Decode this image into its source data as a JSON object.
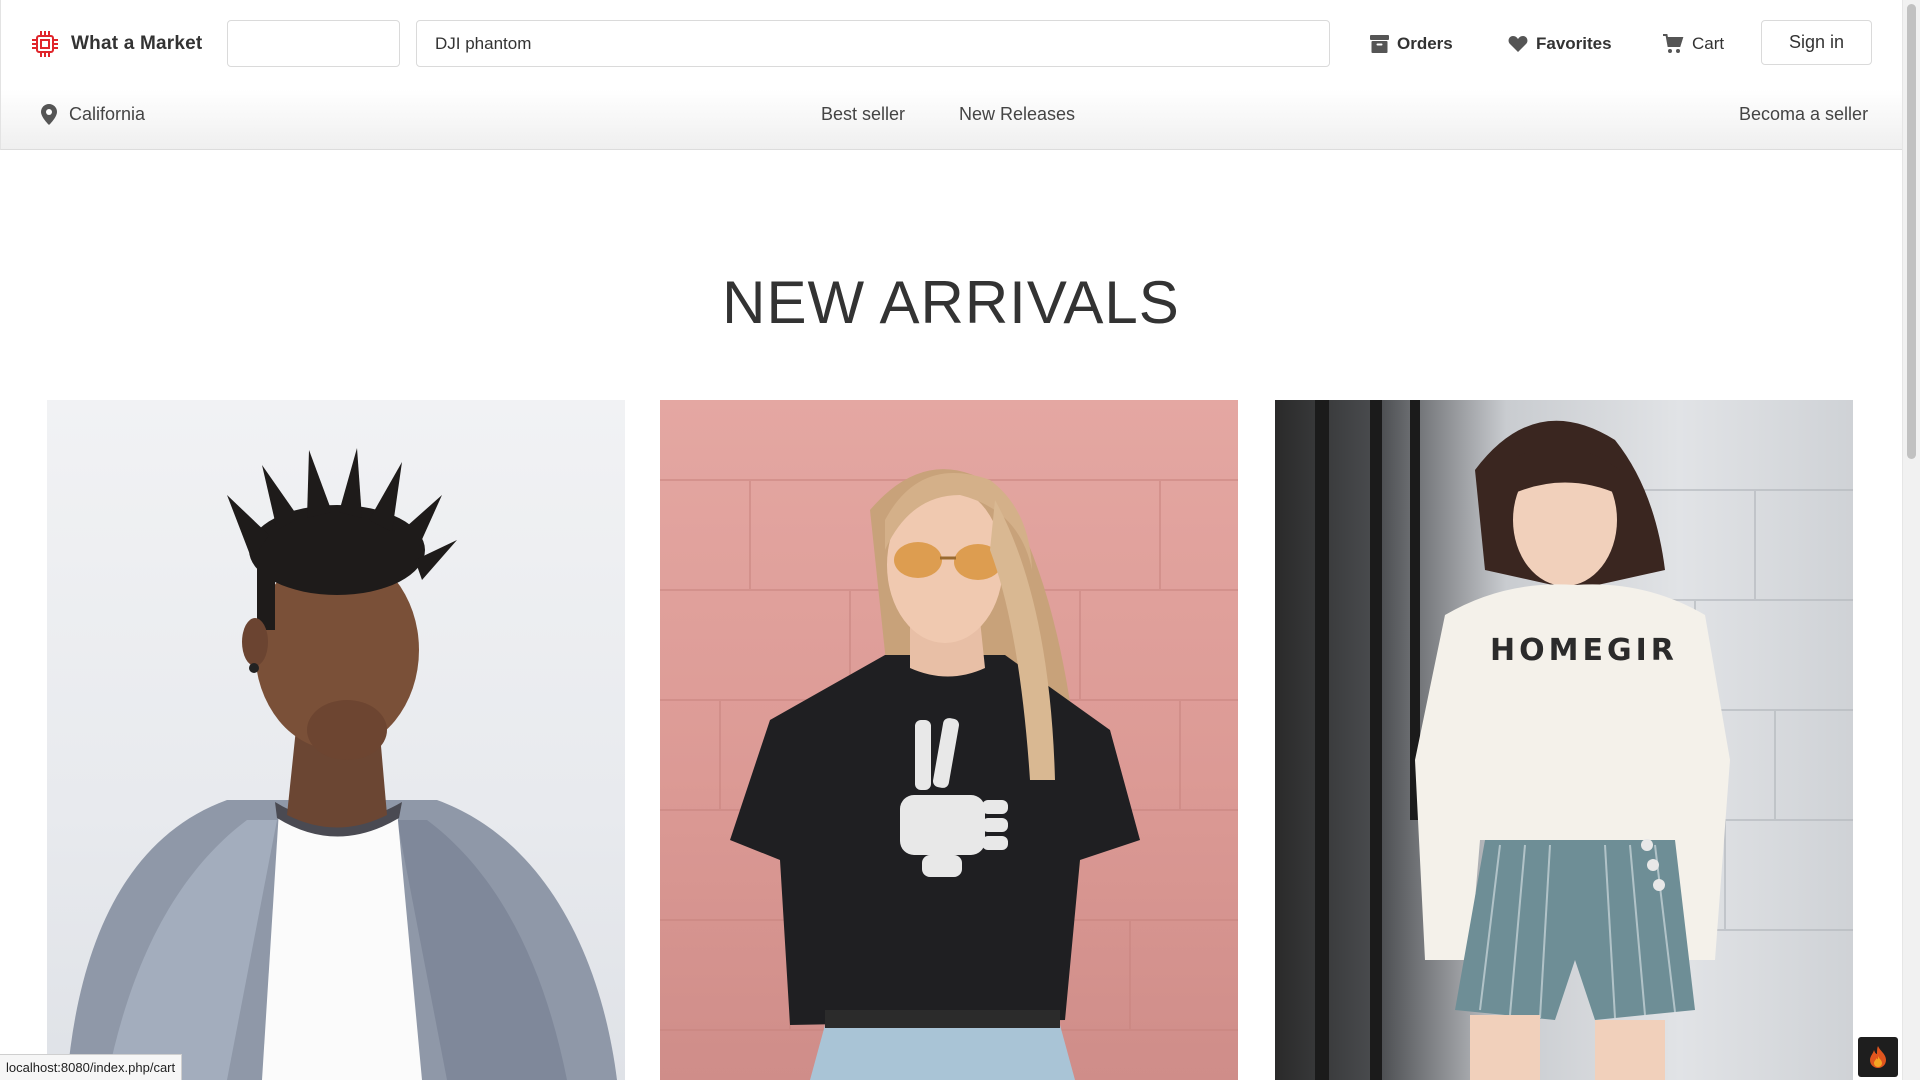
{
  "header": {
    "brand_name": "What a Market",
    "brand_color": "#e0252b",
    "category_value": "",
    "search_value": "DJI phantom",
    "orders_label": "Orders",
    "favorites_label": "Favorites",
    "cart_label": "Cart",
    "signin_label": "Sign in"
  },
  "subnav": {
    "location_label": "California",
    "links": [
      "Best seller",
      "New Releases"
    ],
    "seller_label": "Becoma a seller"
  },
  "main": {
    "section_title": "NEW ARRIVALS",
    "products": [
      {
        "image": "man-in-grey-blazer"
      },
      {
        "image": "woman-black-tee-pink-wall"
      },
      {
        "image": "woman-white-homegirl-sweatshirt",
        "shirt_text": "HOMEGIR"
      }
    ]
  },
  "status_url": "localhost:8080/index.php/cart",
  "icons": {
    "logo": "chip-icon",
    "orders": "archive-box-icon",
    "favorites": "heart-icon",
    "cart": "cart-icon",
    "location": "map-pin-icon",
    "devtools": "flame-icon"
  }
}
